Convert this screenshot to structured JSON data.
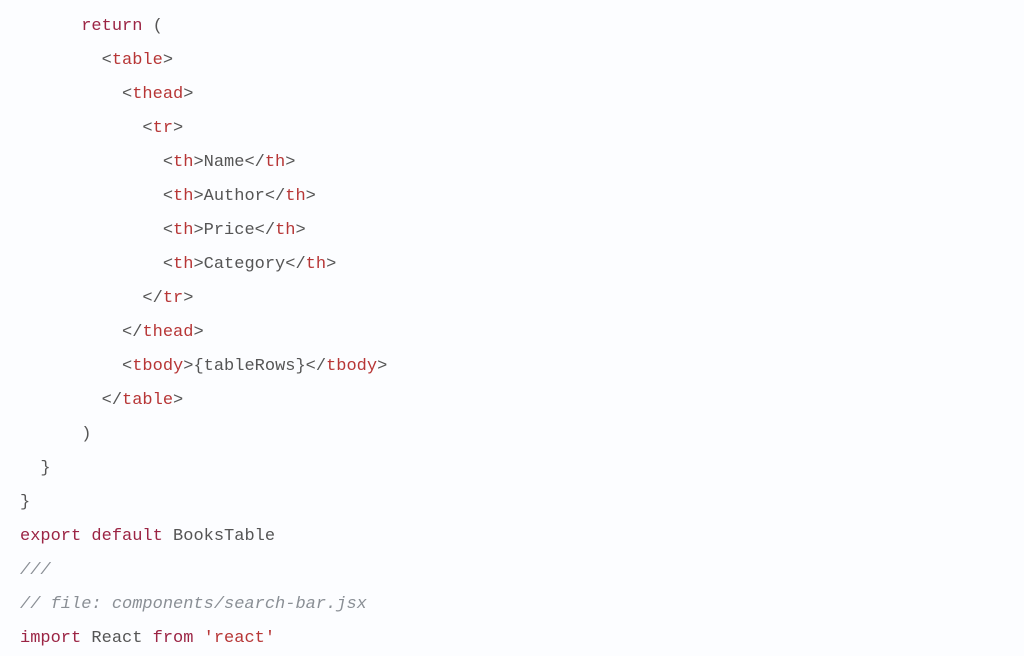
{
  "code": {
    "lines": [
      {
        "indent": 3,
        "tokens": [
          {
            "cls": "kw",
            "t": "return"
          },
          {
            "cls": "plain",
            "t": " ("
          }
        ]
      },
      {
        "indent": 4,
        "tokens": [
          {
            "cls": "punct",
            "t": "<"
          },
          {
            "cls": "tag",
            "t": "table"
          },
          {
            "cls": "punct",
            "t": ">"
          }
        ]
      },
      {
        "indent": 5,
        "tokens": [
          {
            "cls": "punct",
            "t": "<"
          },
          {
            "cls": "tag",
            "t": "thead"
          },
          {
            "cls": "punct",
            "t": ">"
          }
        ]
      },
      {
        "indent": 6,
        "tokens": [
          {
            "cls": "punct",
            "t": "<"
          },
          {
            "cls": "tag",
            "t": "tr"
          },
          {
            "cls": "punct",
            "t": ">"
          }
        ]
      },
      {
        "indent": 7,
        "tokens": [
          {
            "cls": "punct",
            "t": "<"
          },
          {
            "cls": "tag",
            "t": "th"
          },
          {
            "cls": "punct",
            "t": ">"
          },
          {
            "cls": "plain",
            "t": "Name"
          },
          {
            "cls": "punct",
            "t": "</"
          },
          {
            "cls": "tag",
            "t": "th"
          },
          {
            "cls": "punct",
            "t": ">"
          }
        ]
      },
      {
        "indent": 7,
        "tokens": [
          {
            "cls": "punct",
            "t": "<"
          },
          {
            "cls": "tag",
            "t": "th"
          },
          {
            "cls": "punct",
            "t": ">"
          },
          {
            "cls": "plain",
            "t": "Author"
          },
          {
            "cls": "punct",
            "t": "</"
          },
          {
            "cls": "tag",
            "t": "th"
          },
          {
            "cls": "punct",
            "t": ">"
          }
        ]
      },
      {
        "indent": 7,
        "tokens": [
          {
            "cls": "punct",
            "t": "<"
          },
          {
            "cls": "tag",
            "t": "th"
          },
          {
            "cls": "punct",
            "t": ">"
          },
          {
            "cls": "plain",
            "t": "Price"
          },
          {
            "cls": "punct",
            "t": "</"
          },
          {
            "cls": "tag",
            "t": "th"
          },
          {
            "cls": "punct",
            "t": ">"
          }
        ]
      },
      {
        "indent": 7,
        "tokens": [
          {
            "cls": "punct",
            "t": "<"
          },
          {
            "cls": "tag",
            "t": "th"
          },
          {
            "cls": "punct",
            "t": ">"
          },
          {
            "cls": "plain",
            "t": "Category"
          },
          {
            "cls": "punct",
            "t": "</"
          },
          {
            "cls": "tag",
            "t": "th"
          },
          {
            "cls": "punct",
            "t": ">"
          }
        ]
      },
      {
        "indent": 6,
        "tokens": [
          {
            "cls": "punct",
            "t": "</"
          },
          {
            "cls": "tag",
            "t": "tr"
          },
          {
            "cls": "punct",
            "t": ">"
          }
        ]
      },
      {
        "indent": 5,
        "tokens": [
          {
            "cls": "punct",
            "t": "</"
          },
          {
            "cls": "tag",
            "t": "thead"
          },
          {
            "cls": "punct",
            "t": ">"
          }
        ]
      },
      {
        "indent": 5,
        "tokens": [
          {
            "cls": "punct",
            "t": "<"
          },
          {
            "cls": "tag",
            "t": "tbody"
          },
          {
            "cls": "punct",
            "t": ">"
          },
          {
            "cls": "jsexpr",
            "t": "{tableRows}"
          },
          {
            "cls": "punct",
            "t": "</"
          },
          {
            "cls": "tag",
            "t": "tbody"
          },
          {
            "cls": "punct",
            "t": ">"
          }
        ]
      },
      {
        "indent": 4,
        "tokens": [
          {
            "cls": "punct",
            "t": "</"
          },
          {
            "cls": "tag",
            "t": "table"
          },
          {
            "cls": "punct",
            "t": ">"
          }
        ]
      },
      {
        "indent": 3,
        "tokens": [
          {
            "cls": "plain",
            "t": ")"
          }
        ]
      },
      {
        "indent": 1,
        "tokens": [
          {
            "cls": "plain",
            "t": "}"
          }
        ]
      },
      {
        "indent": 0,
        "tokens": [
          {
            "cls": "plain",
            "t": "}"
          }
        ]
      },
      {
        "indent": 0,
        "tokens": [
          {
            "cls": "kw",
            "t": "export"
          },
          {
            "cls": "plain",
            "t": " "
          },
          {
            "cls": "kw",
            "t": "default"
          },
          {
            "cls": "plain",
            "t": " "
          },
          {
            "cls": "ident",
            "t": "BooksTable"
          }
        ]
      },
      {
        "indent": 0,
        "tokens": [
          {
            "cls": "comment",
            "t": "///"
          }
        ]
      },
      {
        "indent": 0,
        "tokens": [
          {
            "cls": "comment",
            "t": "// file: components/search-bar.jsx"
          }
        ]
      },
      {
        "indent": 0,
        "tokens": [
          {
            "cls": "kw",
            "t": "import"
          },
          {
            "cls": "plain",
            "t": " "
          },
          {
            "cls": "ident",
            "t": "React"
          },
          {
            "cls": "plain",
            "t": " "
          },
          {
            "cls": "kw",
            "t": "from"
          },
          {
            "cls": "plain",
            "t": " "
          },
          {
            "cls": "str",
            "t": "'react'"
          }
        ]
      }
    ],
    "indentUnit": "  "
  }
}
